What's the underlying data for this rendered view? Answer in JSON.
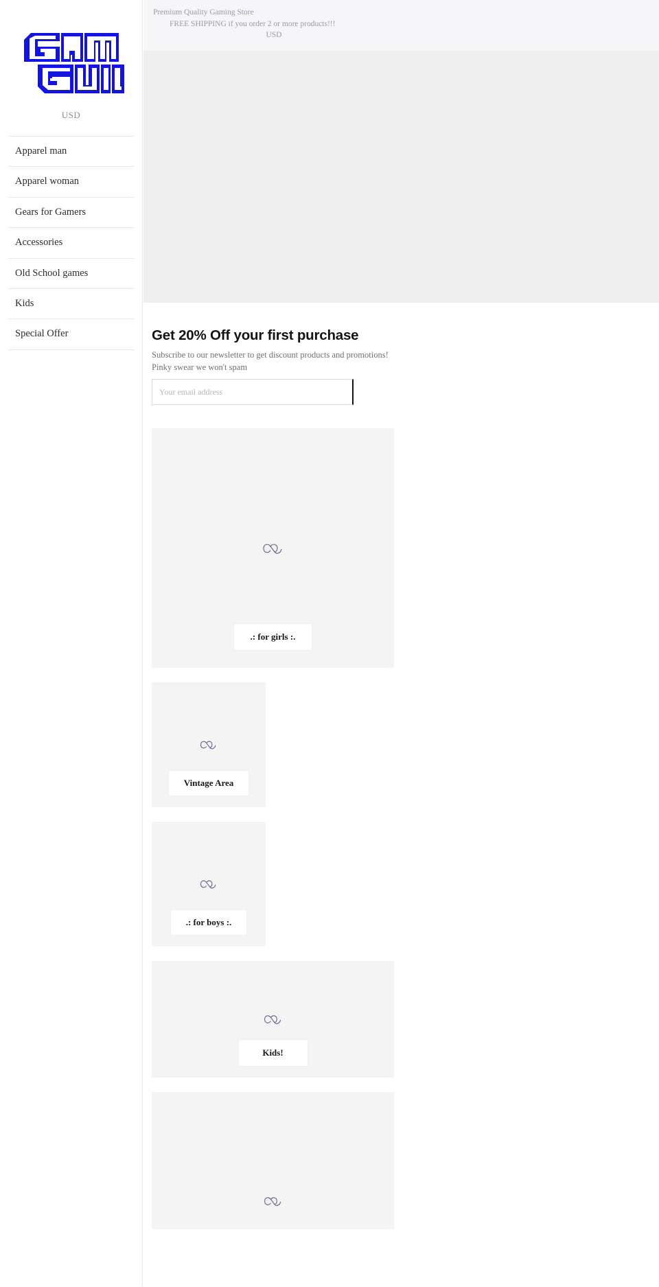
{
  "brand": {
    "logo_text_line1": "GAMER",
    "logo_text_line2": "GUILD",
    "logo_color": "#1414e0",
    "currency": "USD"
  },
  "announcement": {
    "line1": "Premium Quality Gaming Store",
    "line2": "FREE SHIPPING if you order 2 or more products!!!",
    "currency": "USD"
  },
  "sidebar": {
    "currency": "USD",
    "items": [
      {
        "label": "Apparel man"
      },
      {
        "label": "Apparel woman"
      },
      {
        "label": "Gears for Gamers"
      },
      {
        "label": "Accessories"
      },
      {
        "label": "Old School games"
      },
      {
        "label": "Kids"
      },
      {
        "label": "Special Offer"
      }
    ]
  },
  "newsletter": {
    "title": "Get 20% Off your first purchase",
    "subtitle": "Subscribe to our newsletter to get discount products and promotions!",
    "note": "Pinky swear we won't spam",
    "email_placeholder": "Your email address",
    "email_value": ""
  },
  "collections": [
    {
      "label": ".: for girls :.",
      "size": "wide",
      "image": "broken-image-icon"
    },
    {
      "label": "Vintage Area",
      "size": "small",
      "image": "broken-image-icon"
    },
    {
      "label": ".: for boys :.",
      "size": "small",
      "image": "broken-image-icon"
    },
    {
      "label": "Kids!",
      "size": "wide",
      "image": "broken-image-icon"
    },
    {
      "label": "",
      "size": "wide",
      "image": "broken-image-icon"
    }
  ],
  "colors": {
    "accent": "#1414e0",
    "hero_bg": "#eeeeee",
    "card_bg": "#f4f4f5",
    "announce_bg": "#f6f6f8",
    "muted_text": "#9a9aa1"
  }
}
